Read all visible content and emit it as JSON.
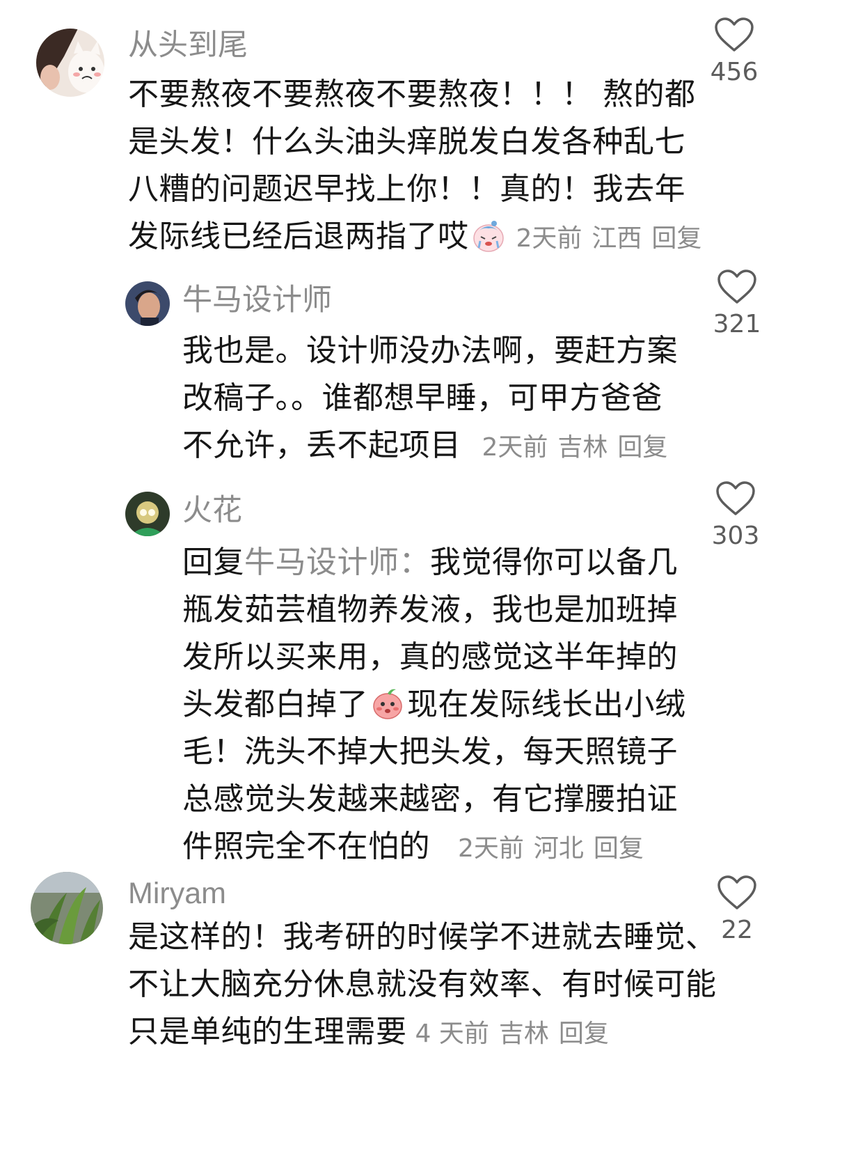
{
  "comments": [
    {
      "username": "从头到尾",
      "lines": [
        "不要熬夜不要熬夜不要熬夜！！！ 熬的都",
        "是头发！什么头油头痒脱发白发各种乱七",
        "八糟的问题迟早找上你！！真的！我去年",
        "发际线已经后退两指了哎"
      ],
      "time": "2天前",
      "location": "江西",
      "reply_label": "回复",
      "likes": "456"
    },
    {
      "username": "牛马设计师",
      "lines": [
        "我也是。设计师没办法啊，要赶方案",
        "改稿子。。谁都想早睡，可甲方爸爸",
        "不允许，丢不起项目"
      ],
      "time": "2天前",
      "location": "吉林",
      "reply_label": "回复",
      "likes": "321"
    },
    {
      "username": "火花",
      "reply_prefix": "回复",
      "reply_to": "牛马设计师：",
      "line1_rest": "我觉得你可以备几",
      "lines": [
        "瓶发茹芸植物养发液，我也是加班掉",
        "发所以买来用，真的感觉这半年掉的"
      ],
      "line4_a": "头发都白掉了",
      "line4_b": "现在发际线长出小绒",
      "lines_after": [
        "毛！洗头不掉大把头发，每天照镜子",
        "总感觉头发越来越密，有它撑腰拍证"
      ],
      "last_line": "件照完全不在怕的",
      "time": "2天前",
      "location": "河北",
      "reply_label": "回复",
      "likes": "303"
    },
    {
      "username": "Miryam",
      "lines": [
        "是这样的！我考研的时候学不进就去睡觉、",
        "不让大脑充分休息就没有效率、有时候可能"
      ],
      "last_line": "只是单纯的生理需要",
      "time": "4 天前",
      "location": "吉林",
      "reply_label": "回复",
      "likes": "22"
    }
  ],
  "colors": {
    "text": "#161616",
    "meta": "#8c8c8c",
    "like_count": "#5c5c5c",
    "background": "#ffffff"
  },
  "icons": {
    "like": "heart-outline-icon",
    "emoji1": "crying-face-emoji",
    "emoji2": "blushing-peach-emoji"
  }
}
